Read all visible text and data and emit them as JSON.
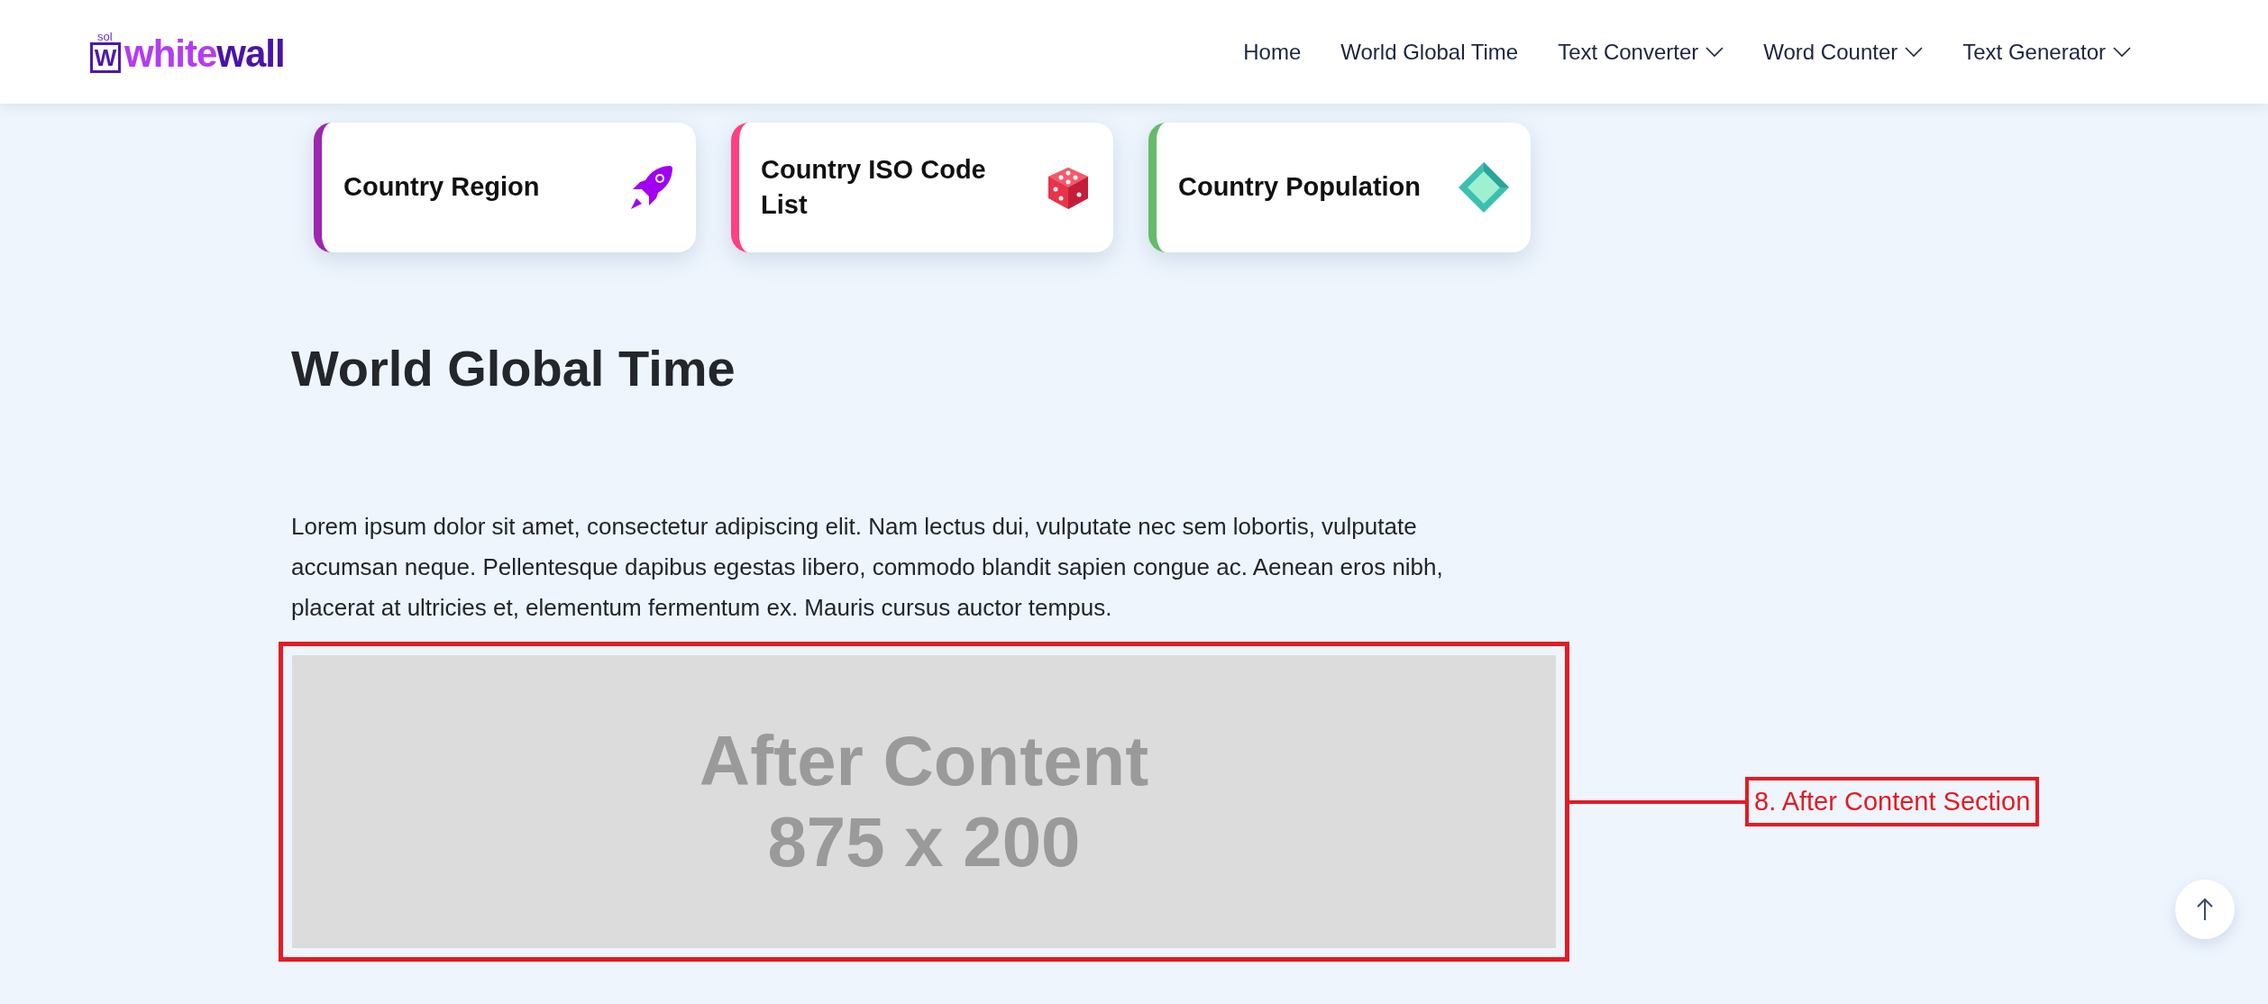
{
  "logo": {
    "tag": "sol",
    "mark": "W",
    "part1": "white",
    "part2": "wall"
  },
  "nav": [
    {
      "label": "Home",
      "dropdown": false
    },
    {
      "label": "World Global Time",
      "dropdown": false
    },
    {
      "label": "Text Converter",
      "dropdown": true
    },
    {
      "label": "Word Counter",
      "dropdown": true
    },
    {
      "label": "Text Generator",
      "dropdown": true
    }
  ],
  "cards": [
    {
      "title": "Country Region",
      "color": "#9c27b0",
      "kind": "rocket"
    },
    {
      "title": "Country ISO Code List",
      "color": "#ff4081",
      "kind": "dice"
    },
    {
      "title": "Country Population",
      "color": "#66bb6a",
      "kind": "gem"
    }
  ],
  "heading": "World Global Time",
  "paragraph": "Lorem ipsum dolor sit amet, consectetur adipiscing elit. Nam lectus dui, vulputate nec sem lobortis, vulputate accumsan neque. Pellentesque dapibus egestas libero, commodo blandit sapien congue ac. Aenean eros nibh, placerat at ultricies et, elementum fermentum ex. Mauris cursus auctor tempus.",
  "ad": {
    "line1": "After Content",
    "line2": "875 x 200"
  },
  "annotation": "8. After Content Section"
}
